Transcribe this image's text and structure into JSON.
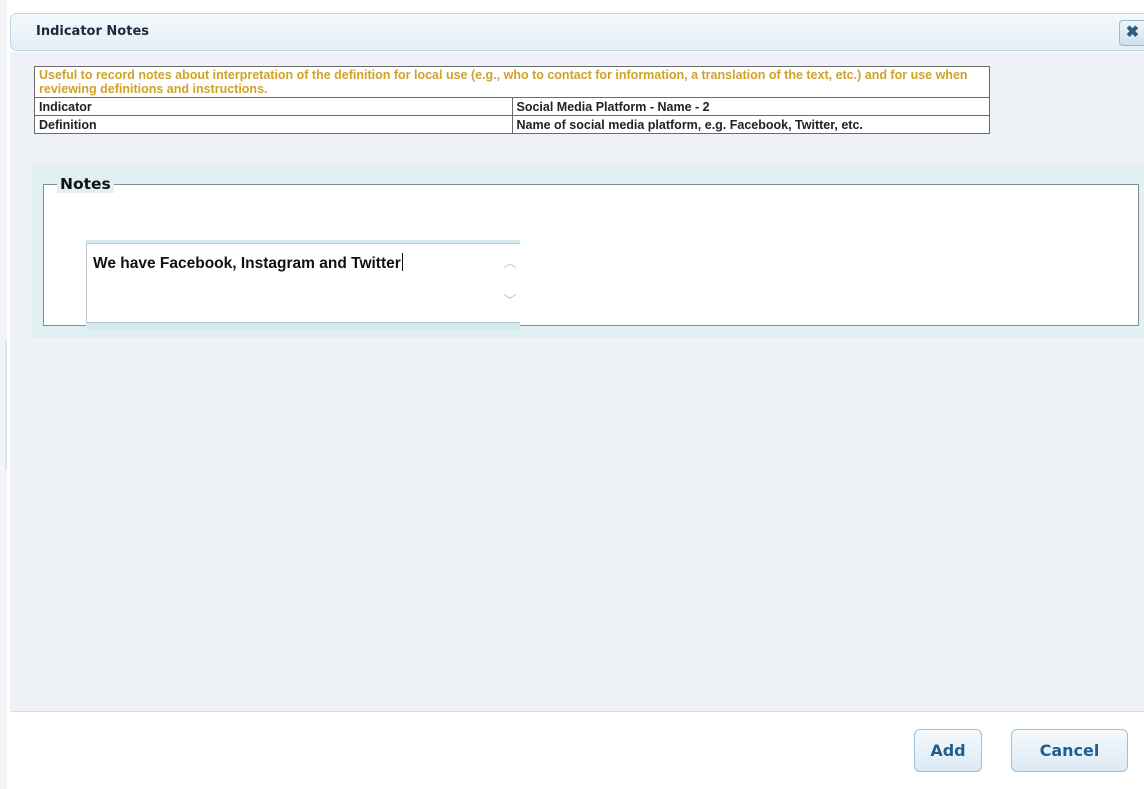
{
  "dialog": {
    "title": "Indicator Notes",
    "close_icon": "close-icon",
    "close_glyph": "✖"
  },
  "info": {
    "description": "Useful to record notes about interpretation of the definition for local use (e.g., who to contact for information, a translation of the text, etc.) and for use when reviewing definitions and instructions.",
    "rows": [
      {
        "label": "Indicator",
        "value": "Social Media Platform - Name - 2"
      },
      {
        "label": "Definition",
        "value": "Name of social media platform, e.g. Facebook, Twitter, etc."
      }
    ]
  },
  "notes": {
    "legend": "Notes",
    "value": "We have Facebook, Instagram and Twitter",
    "scroll_up_icon": "chevron-up-icon",
    "scroll_down_icon": "chevron-down-icon"
  },
  "footer": {
    "add_label": "Add",
    "cancel_label": "Cancel"
  },
  "colors": {
    "description_text": "#d1a227",
    "button_text": "#1f5f8f",
    "notes_panel_bg": "#e1f1f3"
  }
}
